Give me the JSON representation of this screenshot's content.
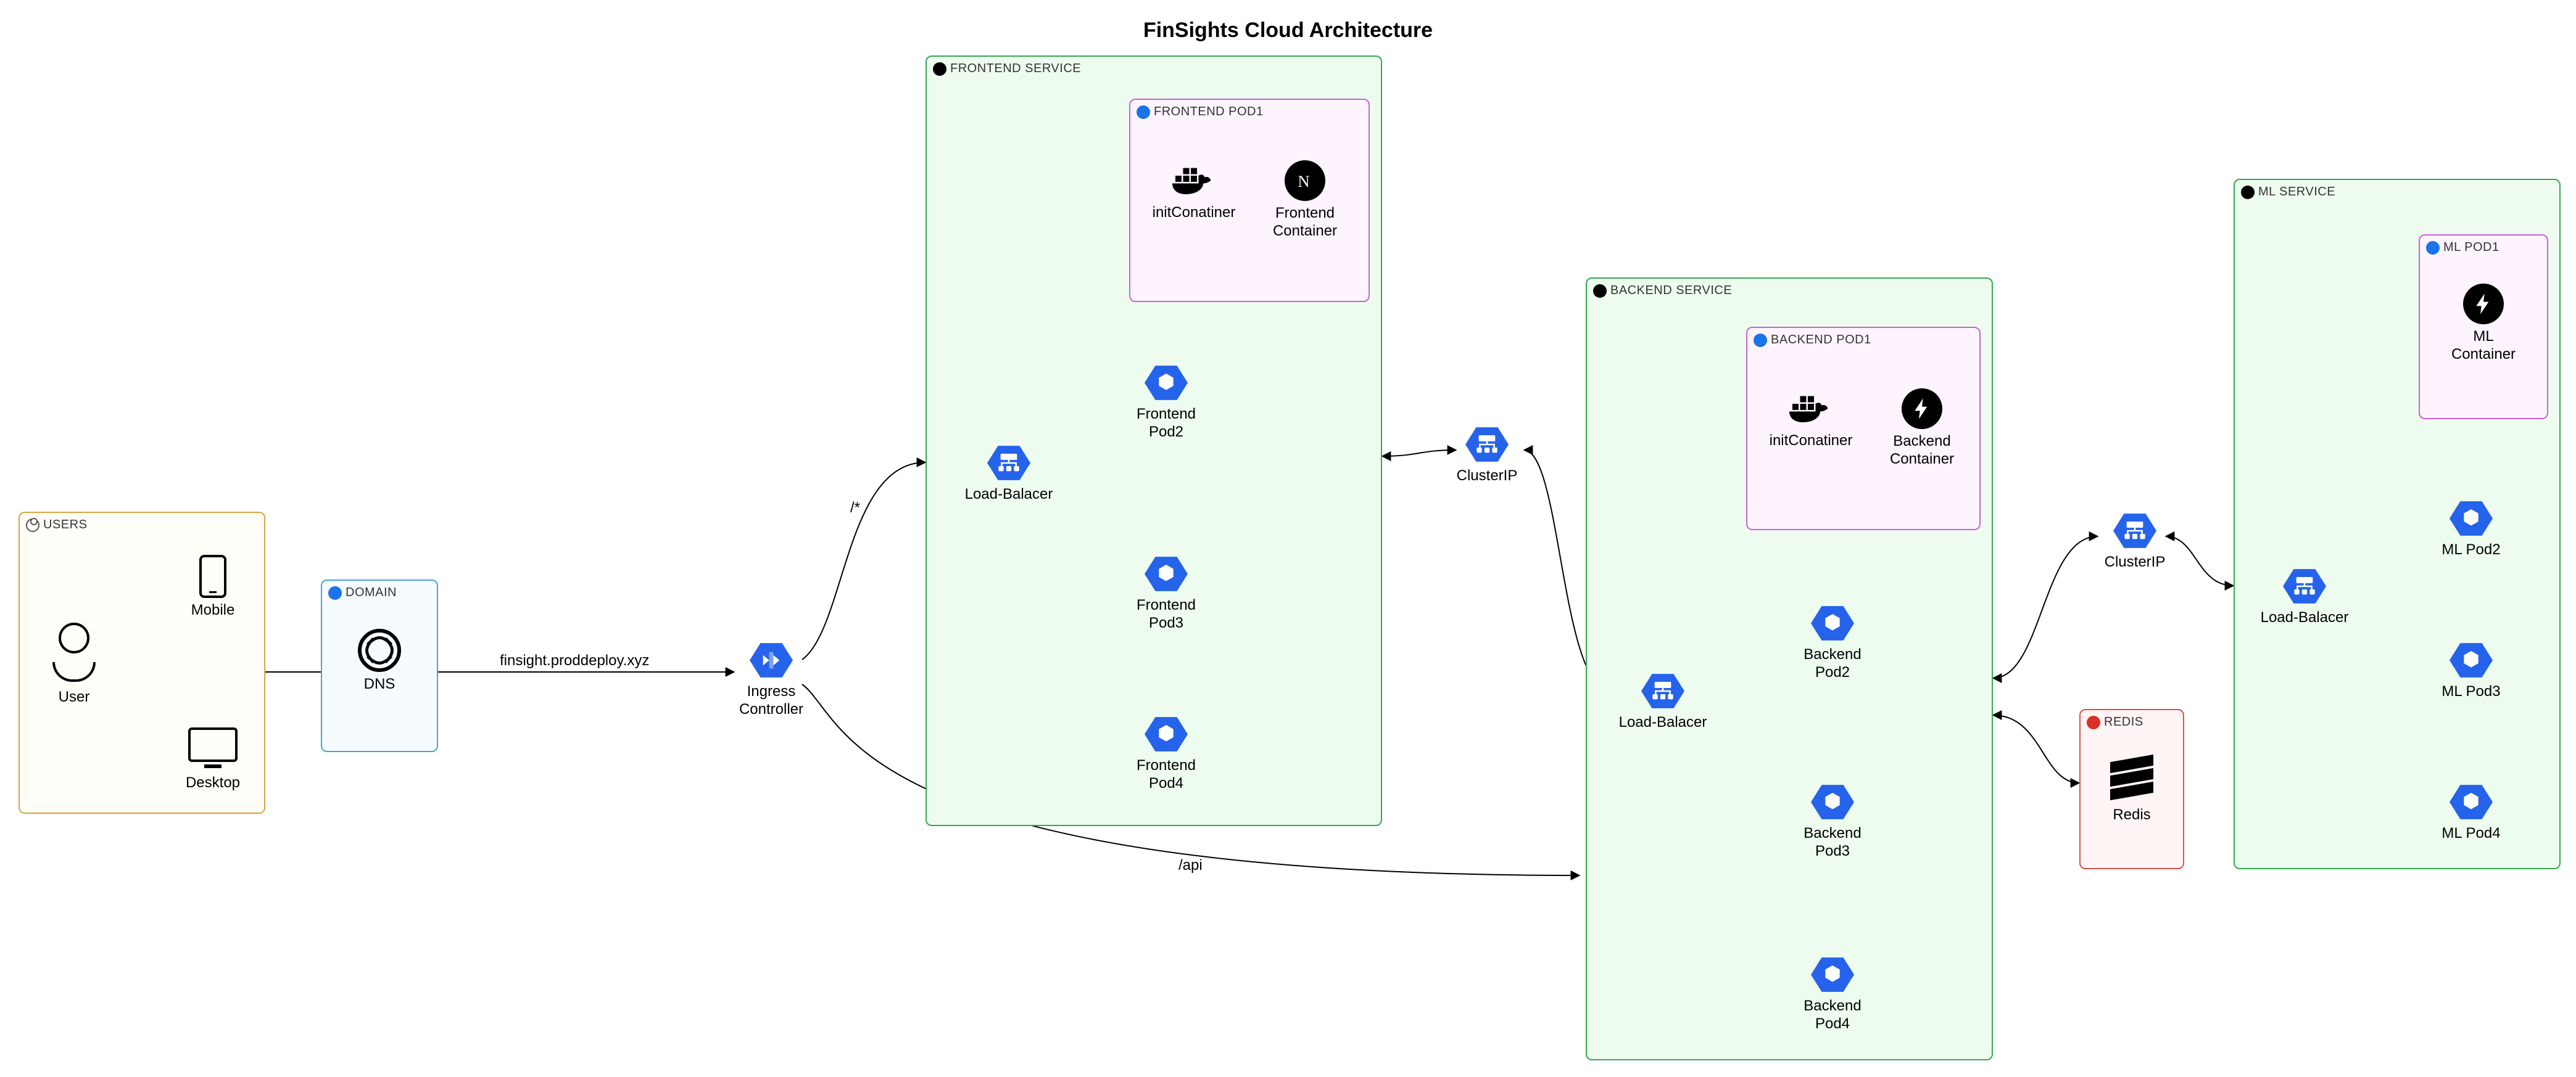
{
  "title": "FinSights Cloud Architecture",
  "groups": {
    "users": "USERS",
    "domain": "DOMAIN",
    "frontend_service": "FRONTEND SERVICE",
    "frontend_pod1": "FRONTEND POD1",
    "backend_service": "BACKEND SERVICE",
    "backend_pod1": "BACKEND POD1",
    "redis": "REDIS",
    "ml_service": "ML SERVICE",
    "ml_pod1": "ML POD1"
  },
  "nodes": {
    "user": "User",
    "mobile": "Mobile",
    "desktop": "Desktop",
    "dns": "DNS",
    "ingress": "Ingress\nController",
    "fe_lb": "Load-Balacer",
    "fe_pod2": "Frontend\nPod2",
    "fe_pod3": "Frontend\nPod3",
    "fe_pod4": "Frontend\nPod4",
    "init_container_fe": "initConatiner",
    "fe_container": "Frontend\nContainer",
    "cluster_ip_fe": "ClusterIP",
    "be_lb": "Load-Balacer",
    "be_pod2": "Backend\nPod2",
    "be_pod3": "Backend\nPod3",
    "be_pod4": "Backend\nPod4",
    "init_container_be": "initConatiner",
    "be_container": "Backend\nContainer",
    "cluster_ip_be": "ClusterIP",
    "redis": "Redis",
    "ml_lb": "Load-Balacer",
    "ml_pod2": "ML Pod2",
    "ml_pod3": "ML Pod3",
    "ml_pod4": "ML Pod4",
    "ml_container": "ML\nContainer"
  },
  "edges": {
    "domain": "finsight.proddeploy.xyz",
    "root_path": "/*",
    "api_path": "/api"
  },
  "colors": {
    "users_border": "#d9a441",
    "domain_border": "#4aa3d0",
    "service_border": "#34a853",
    "service_bg": "#eefcef",
    "pod_border": "#c862d6",
    "pod_bg": "#fdf4ff",
    "redis_border": "#d9534f",
    "redis_bg": "#fff5f4",
    "hex_blue": "#2563eb"
  },
  "diagram": {
    "entry": [
      "User",
      "Mobile/Desktop",
      "DNS"
    ],
    "routing": {
      "domain_record": "finsight.proddeploy.xyz",
      "ingress_routes": [
        {
          "path": "/*",
          "target": "FRONTEND SERVICE"
        },
        {
          "path": "/api",
          "target": "BACKEND SERVICE"
        }
      ],
      "bidirectional_links": [
        [
          "FRONTEND SERVICE.Load-Balacer",
          "ClusterIP"
        ],
        [
          "ClusterIP",
          "BACKEND SERVICE.Load-Balacer"
        ],
        [
          "BACKEND SERVICE",
          "ClusterIP (ML)"
        ],
        [
          "BACKEND SERVICE",
          "REDIS"
        ],
        [
          "ClusterIP (ML)",
          "ML SERVICE.Load-Balacer"
        ]
      ]
    },
    "services": {
      "FRONTEND SERVICE": {
        "load_balancer_to": [
          "FRONTEND POD1",
          "Frontend Pod2",
          "Frontend Pod3",
          "Frontend Pod4"
        ],
        "pod1_containers": [
          "initConatiner",
          "Frontend Container"
        ]
      },
      "BACKEND SERVICE": {
        "load_balancer_to": [
          "BACKEND POD1",
          "Backend Pod2",
          "Backend Pod3",
          "Backend Pod4"
        ],
        "pod1_containers": [
          "initConatiner",
          "Backend Container"
        ]
      },
      "ML SERVICE": {
        "load_balancer_to": [
          "ML POD1",
          "ML Pod2",
          "ML Pod3",
          "ML Pod4"
        ],
        "pod1_containers": [
          "ML Container"
        ]
      }
    },
    "cache": "Redis"
  }
}
